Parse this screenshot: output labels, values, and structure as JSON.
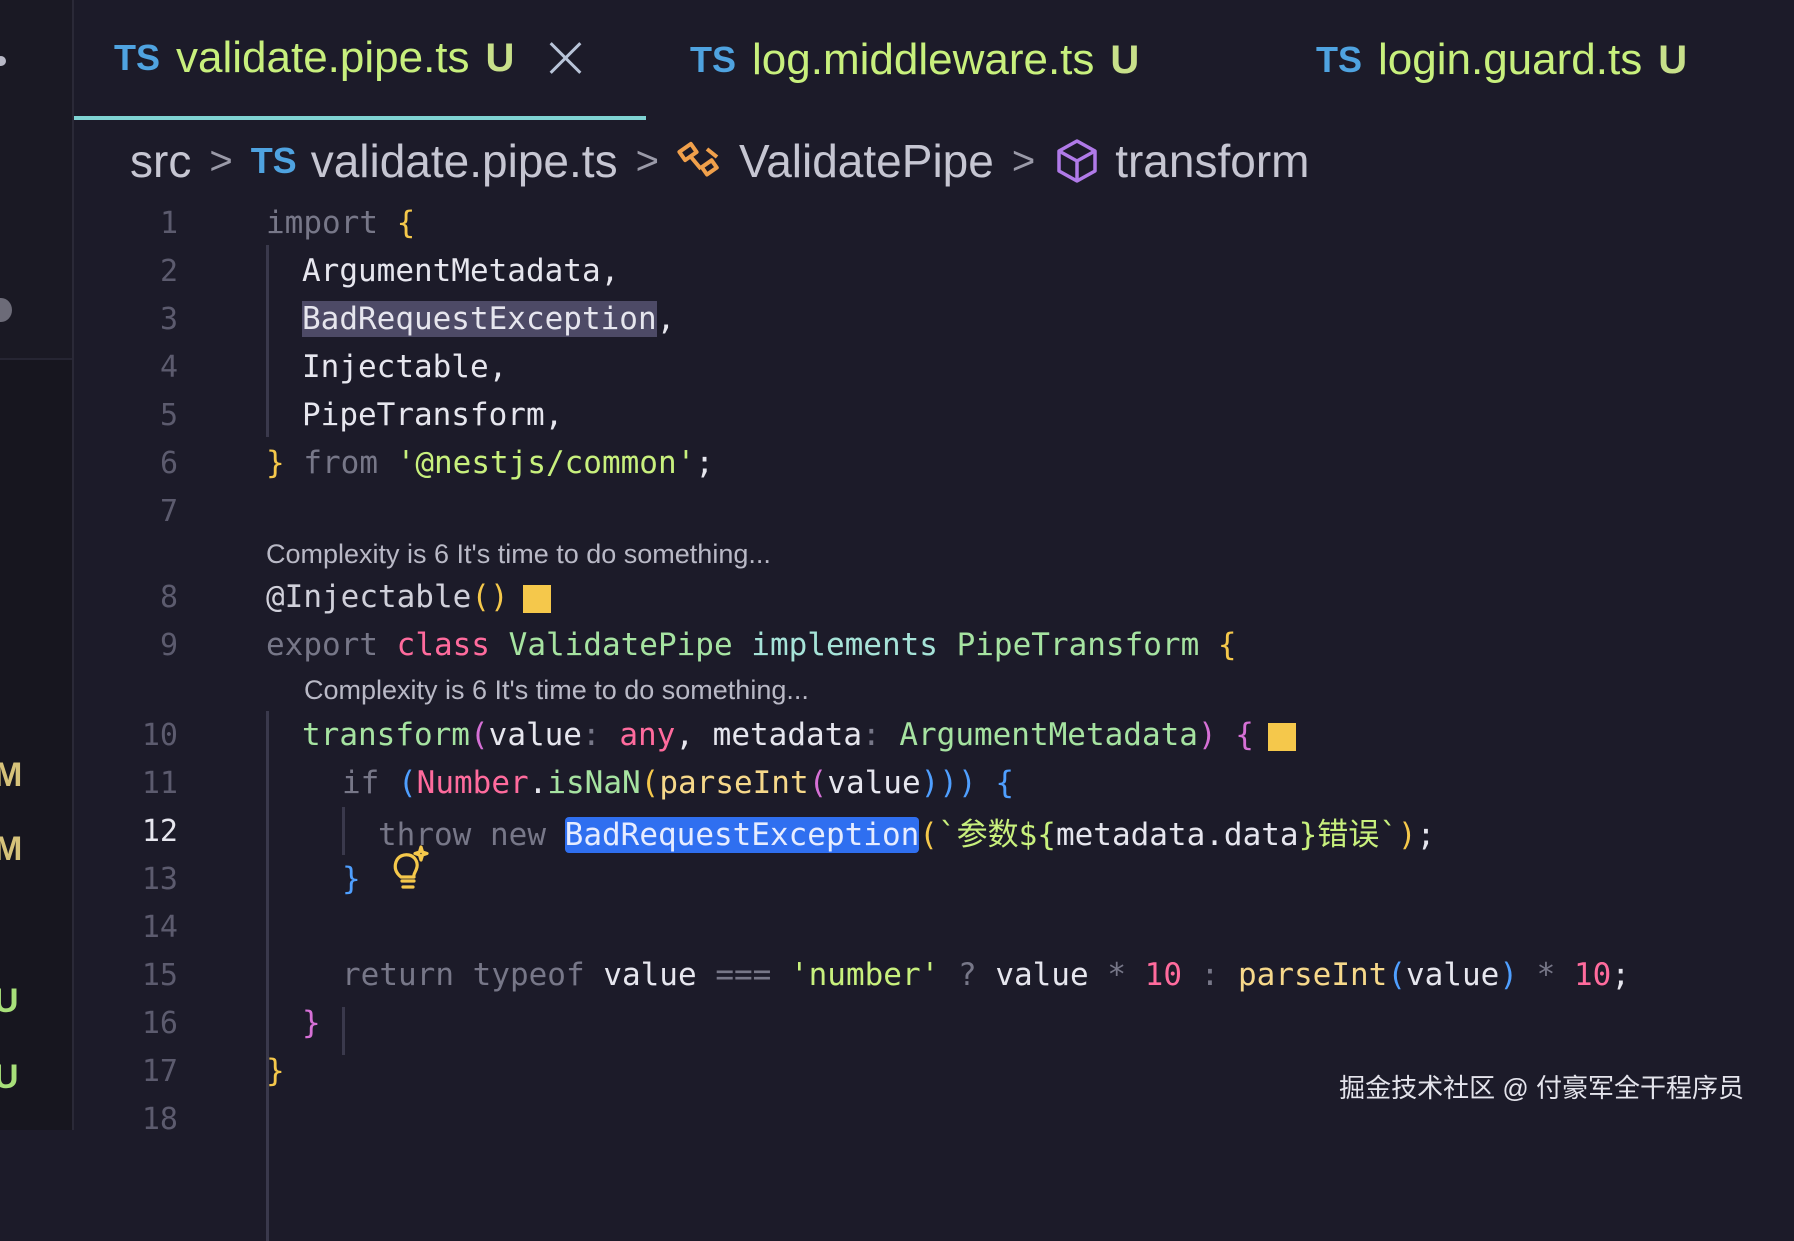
{
  "tabs": [
    {
      "lang": "TS",
      "name": "validate.pipe.ts",
      "status": "U",
      "active": true
    },
    {
      "lang": "TS",
      "name": "log.middleware.ts",
      "status": "U",
      "active": false
    },
    {
      "lang": "TS",
      "name": "login.guard.ts",
      "status": "U",
      "active": false
    }
  ],
  "breadcrumb": {
    "folder": "src",
    "file_lang": "TS",
    "file": "validate.pipe.ts",
    "class": "ValidatePipe",
    "method": "transform"
  },
  "sidebar_badges": [
    "M",
    "M",
    "U",
    "U"
  ],
  "code": {
    "current_line": "12",
    "lens_text": "Complexity is 6 It's time to do something...",
    "lines": {
      "l1": {
        "num": "1",
        "kw": "import",
        "brace": "{"
      },
      "l2": {
        "num": "2",
        "ident": "ArgumentMetadata",
        "punct": ","
      },
      "l3": {
        "num": "3",
        "ident": "BadRequestException",
        "punct": ","
      },
      "l4": {
        "num": "4",
        "ident": "Injectable",
        "punct": ","
      },
      "l5": {
        "num": "5",
        "ident": "PipeTransform",
        "punct": ","
      },
      "l6": {
        "num": "6",
        "brace": "}",
        "kw": "from",
        "str": "'@nestjs/common'",
        "punct": ";"
      },
      "l7": {
        "num": "7"
      },
      "l8": {
        "num": "8",
        "decorator": "@Injectable",
        "parens": "()"
      },
      "l9": {
        "num": "9",
        "kw1": "export",
        "kw2": "class",
        "name": "ValidatePipe",
        "kw3": "implements",
        "iface": "PipeTransform",
        "brace": "{"
      },
      "l10": {
        "num": "10",
        "fn": "transform",
        "p1": "(",
        "a1": "value",
        "c1": ":",
        "t1": "any",
        "comma": ",",
        "a2": "metadata",
        "c2": ":",
        "t2": "ArgumentMetadata",
        "p2": ")",
        "brace": "{"
      },
      "l11": {
        "num": "11",
        "kw": "if",
        "p1": "(",
        "obj": "Number",
        "dot": ".",
        "m": "isNaN",
        "p2": "(",
        "f": "parseInt",
        "p3": "(",
        "arg": "value",
        "close": ")))",
        "brace": "{"
      },
      "l12": {
        "num": "12",
        "kw1": "throw",
        "kw2": "new",
        "cls": "BadRequestException",
        "p1": "(",
        "s1": "`参数${",
        "expr": "metadata.data",
        "s2": "}错误`",
        "p2": ")",
        "punct": ";"
      },
      "l13": {
        "num": "13",
        "brace": "}"
      },
      "l14": {
        "num": "14"
      },
      "l15": {
        "num": "15",
        "kw1": "return",
        "kw2": "typeof",
        "v1": "value",
        "op1": "===",
        "s": "'number'",
        "q": "?",
        "v2": "value",
        "m1": "*",
        "n1": "10",
        "col": ":",
        "f": "parseInt",
        "p1": "(",
        "v3": "value",
        "p2": ")",
        "m2": "*",
        "n2": "10",
        "punct": ";"
      },
      "l16": {
        "num": "16",
        "brace": "}"
      },
      "l17": {
        "num": "17",
        "brace": "}"
      },
      "l18": {
        "num": "18"
      }
    }
  },
  "watermark": "掘金技术社区 @ 付豪军全干程序员"
}
